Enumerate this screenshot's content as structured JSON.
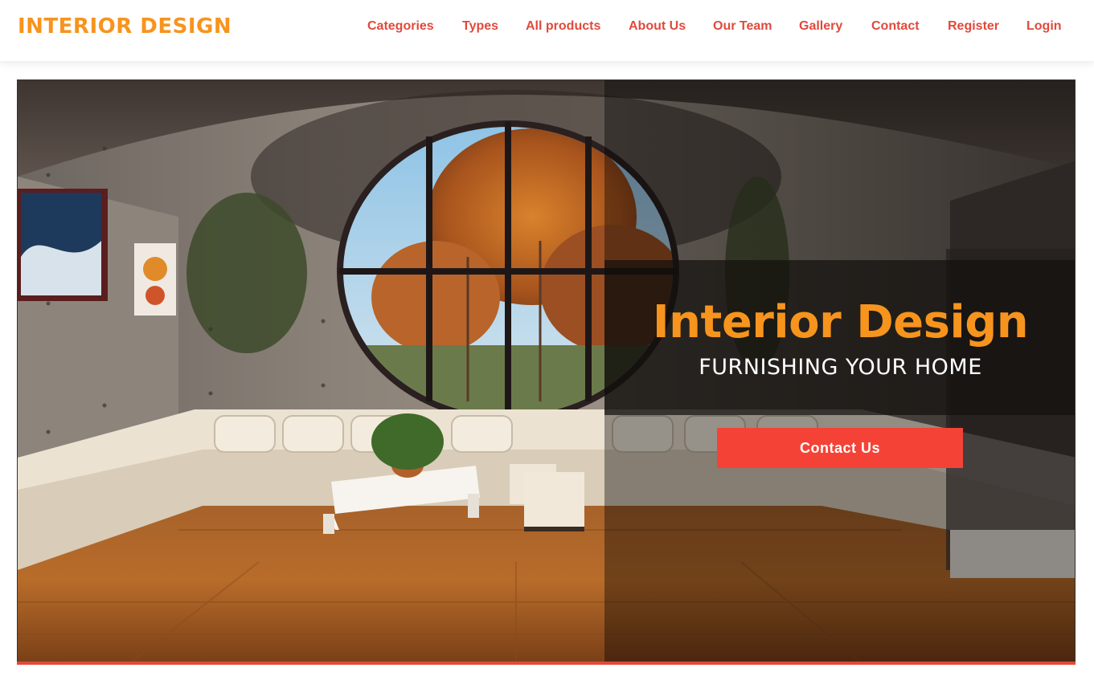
{
  "brand": {
    "name": "INTERIOR DESIGN"
  },
  "nav": {
    "items": [
      {
        "label": "Categories"
      },
      {
        "label": "Types"
      },
      {
        "label": "All products"
      },
      {
        "label": "About Us"
      },
      {
        "label": "Our Team"
      },
      {
        "label": "Gallery"
      },
      {
        "label": "Contact"
      },
      {
        "label": "Register"
      },
      {
        "label": "Login"
      }
    ]
  },
  "hero": {
    "title": "Interior Design",
    "subtitle": "FURNISHING YOUR HOME",
    "cta_label": "Contact Us"
  },
  "colors": {
    "brand_orange": "#f7941d",
    "nav_link": "#e04a3c",
    "cta_red": "#f44336"
  }
}
